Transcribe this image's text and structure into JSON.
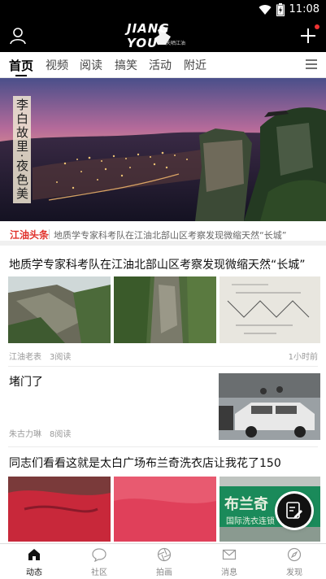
{
  "status_bar": {
    "time": "11:08"
  },
  "header": {
    "logo_text": "JIANG YOU",
    "logo_sub": "天晒江油"
  },
  "tabs": [
    {
      "label": "首页",
      "active": true
    },
    {
      "label": "视频",
      "active": false
    },
    {
      "label": "阅读",
      "active": false
    },
    {
      "label": "搞笑",
      "active": false
    },
    {
      "label": "活动",
      "active": false
    },
    {
      "label": "附近",
      "active": false
    }
  ],
  "banner": {
    "caption": "李白故里·夜色美"
  },
  "ticker": {
    "tag": "江油头条",
    "text": "地质学专家科考队在江油北部山区考察发现微缩天然“长城”"
  },
  "articles": [
    {
      "title": "地质学专家科考队在江油北部山区考察发现微缩天然“长城”",
      "author": "江油老表",
      "reads": "3阅读",
      "time": "1小时前"
    },
    {
      "title": "堵门了",
      "author": "朱古力琳",
      "reads": "8阅读"
    },
    {
      "title": "同志们看看这就是太白广场布兰奇洗衣店让我花了150",
      "sign_text": "布兰奇",
      "sign_sub": "国际洗衣连锁"
    }
  ],
  "bottom_nav": [
    {
      "label": "动态",
      "icon": "home-icon",
      "active": true
    },
    {
      "label": "社区",
      "icon": "chat-bubble-icon",
      "active": false
    },
    {
      "label": "拍画",
      "icon": "aperture-icon",
      "active": false
    },
    {
      "label": "消息",
      "icon": "mail-icon",
      "active": false
    },
    {
      "label": "发现",
      "icon": "compass-icon",
      "active": false
    }
  ],
  "colors": {
    "accent_red": "#e0302a",
    "header_bg": "#000000"
  }
}
